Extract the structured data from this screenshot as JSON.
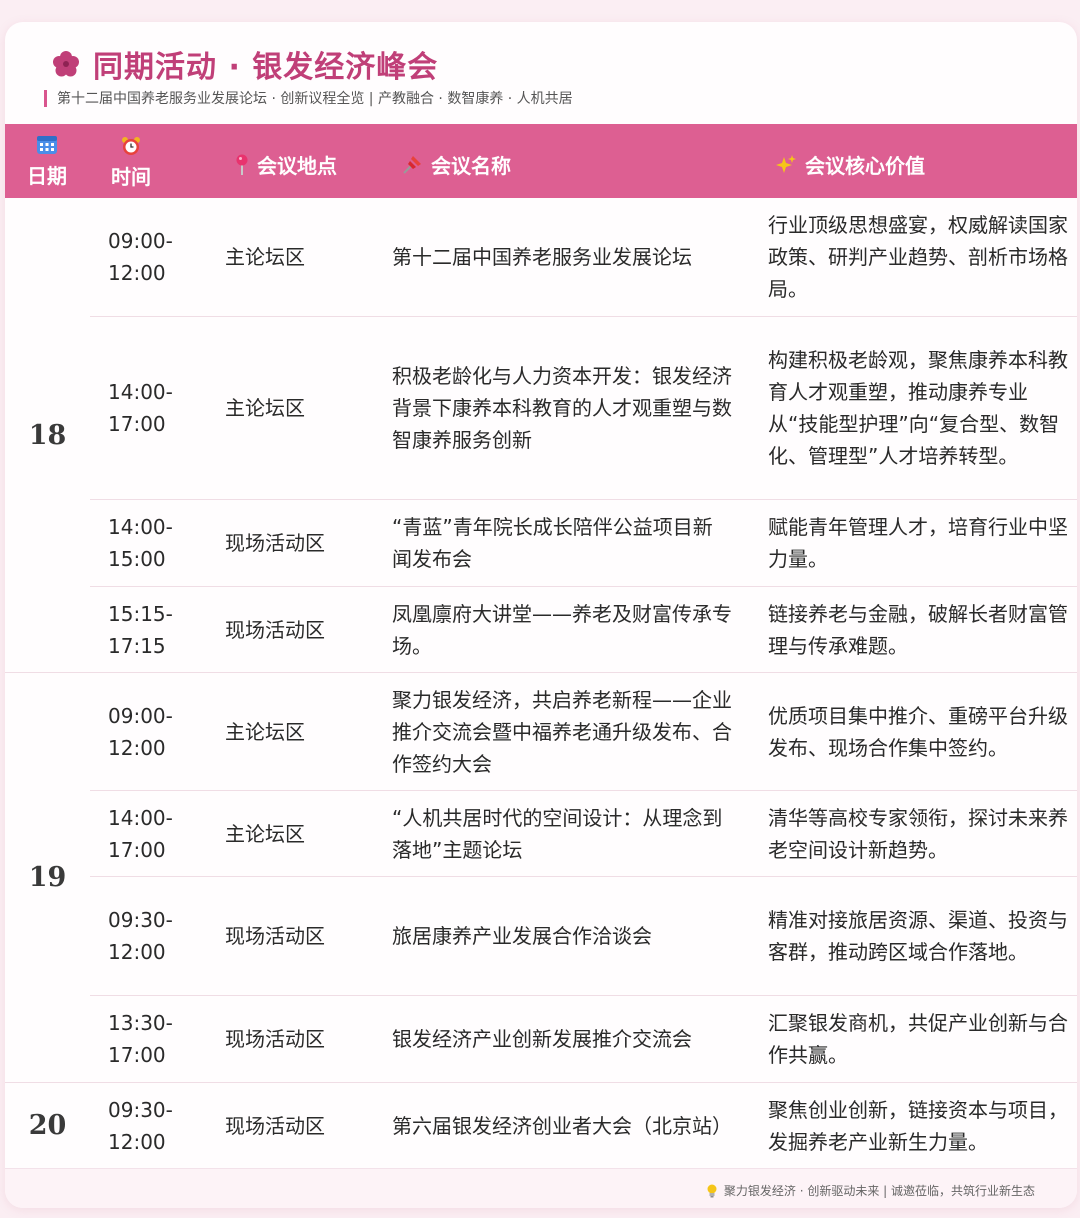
{
  "header": {
    "title": "同期活动 · 银发经济峰会",
    "subtitle": "第十二届中国养老服务业发展论坛 · 创新议程全览 | 产教融合 · 数智康养 · 人机共居"
  },
  "columns": {
    "date": "日期",
    "time": "时间",
    "location": "会议地点",
    "name": "会议名称",
    "value": "会议核心价值"
  },
  "days": [
    {
      "day": "18",
      "sessions": [
        {
          "time": "09:00-\n12:00",
          "location": "主论坛区",
          "name": "第十二届中国养老服务业发展论坛",
          "value": "行业顶级思想盛宴，权威解读国家政策、研判产业趋势、剖析市场格局。"
        },
        {
          "time": "14:00-\n17:00",
          "location": "主论坛区",
          "name": "积极老龄化与人力资本开发：银发经济背景下康养本科教育的人才观重塑与数智康养服务创新",
          "value": "构建积极老龄观，聚焦康养本科教育人才观重塑，推动康养专业从“技能型护理”向“复合型、数智化、管理型”人才培养转型。"
        },
        {
          "time": "14:00-\n15:00",
          "location": "现场活动区",
          "name": "“青蓝”青年院长成长陪伴公益项目新闻发布会",
          "value": "赋能青年管理人才，培育行业中坚力量。"
        },
        {
          "time": "15:15-\n17:15",
          "location": "现场活动区",
          "name": "凤凰廪府大讲堂——养老及财富传承专场。",
          "value": "链接养老与金融，破解长者财富管理与传承难题。"
        }
      ]
    },
    {
      "day": "19",
      "sessions": [
        {
          "time": "09:00-\n12:00",
          "location": "主论坛区",
          "name": "聚力银发经济，共启养老新程——企业推介交流会暨中福养老通升级发布、合作签约大会",
          "value": "优质项目集中推介、重磅平台升级发布、现场合作集中签约。"
        },
        {
          "time": "14:00-\n17:00",
          "location": "主论坛区",
          "name": "“人机共居时代的空间设计：从理念到落地”主题论坛",
          "value": "清华等高校专家领衔，探讨未来养老空间设计新趋势。"
        },
        {
          "time": "09:30-\n12:00",
          "location": "现场活动区",
          "name": "旅居康养产业发展合作洽谈会",
          "value": "精准对接旅居资源、渠道、投资与客群，推动跨区域合作落地。"
        },
        {
          "time": "13:30-\n17:00",
          "location": "现场活动区",
          "name": "银发经济产业创新发展推介交流会",
          "value": "汇聚银发商机，共促产业创新与合作共赢。"
        }
      ]
    },
    {
      "day": "20",
      "sessions": [
        {
          "time": "09:30-\n12:00",
          "location": "现场活动区",
          "name": "第六届银发经济创业者大会（北京站）",
          "value": "聚焦创业创新，链接资本与项目，发掘养老产业新生力量。"
        }
      ]
    }
  ],
  "footer": {
    "text": "聚力银发经济 · 创新驱动未来 | 诚邀莅临，共筑行业新生态"
  },
  "icons": {
    "title": "flower-icon",
    "date": "calendar-icon",
    "time": "alarm-clock-icon",
    "location": "pin-icon",
    "name": "pushpin-icon",
    "value": "sparkles-icon",
    "footer": "lightbulb-icon"
  },
  "colors": {
    "accent": "#c03f78",
    "header_bg": "#dd5f92",
    "page_bg": "#fbeef3"
  }
}
